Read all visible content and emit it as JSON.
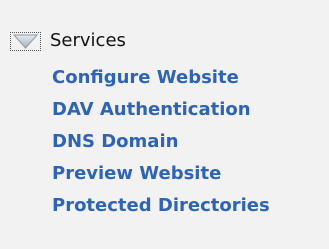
{
  "tree": {
    "section_label": "Services",
    "toggle_icon": "collapse-triangle-icon",
    "link_color": "#2f63b4",
    "items": [
      {
        "label": "Configure Website"
      },
      {
        "label": "DAV Authentication"
      },
      {
        "label": "DNS Domain"
      },
      {
        "label": "Preview Website"
      },
      {
        "label": "Protected Directories"
      }
    ]
  }
}
